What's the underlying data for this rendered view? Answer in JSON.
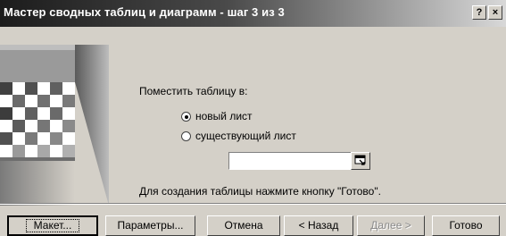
{
  "window": {
    "title": "Мастер сводных таблиц и диаграмм - шаг 3 из 3",
    "help_label": "?",
    "close_label": "×"
  },
  "main": {
    "place_label": "Поместить таблицу в:",
    "options": [
      {
        "label": "новый лист",
        "selected": true
      },
      {
        "label": "существующий лист",
        "selected": false
      }
    ],
    "range_value": "",
    "instruction": "Для создания таблицы нажмите кнопку \"Готово\"."
  },
  "buttons": {
    "layout": "Макет...",
    "options": "Параметры...",
    "cancel": "Отмена",
    "back": "< Назад",
    "next": "Далее >",
    "finish": "Готово"
  },
  "icons": {
    "range_button": "collapse-dialog-icon",
    "art": "wizard-checkerboard-art"
  }
}
